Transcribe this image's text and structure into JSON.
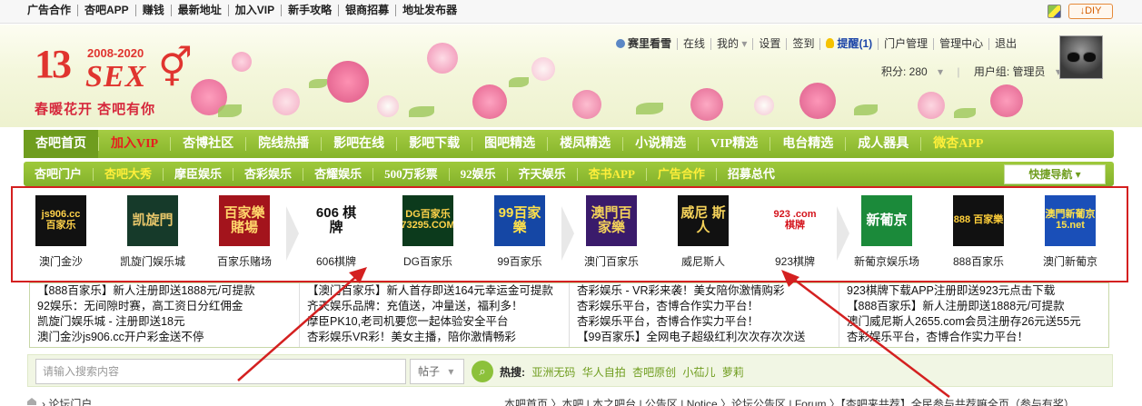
{
  "topbar": {
    "links": [
      {
        "label": "广告合作",
        "red": true
      },
      {
        "label": "杏吧APP",
        "red": false
      },
      {
        "label": "赚钱",
        "red": false
      },
      {
        "label": "最新地址",
        "red": false
      },
      {
        "label": "加入VIP",
        "red": true
      },
      {
        "label": "新手攻略",
        "red": true
      },
      {
        "label": "银商招募",
        "red": false
      },
      {
        "label": "地址发布器",
        "red": false
      }
    ],
    "diy_label": "↓DIY"
  },
  "logo": {
    "number": "13",
    "years": "2008-2020",
    "text": "SEX",
    "slogan": "春暖花开 杏吧有你"
  },
  "user": {
    "name": "赛里看雪",
    "status": "在线",
    "my": "我的",
    "settings": "设置",
    "checkin": "签到",
    "remind": "提醒(1)",
    "portal_admin": "门户管理",
    "admin_center": "管理中心",
    "logout": "退出",
    "points": "积分: 280",
    "group": "用户组: 管理员"
  },
  "nav1": [
    {
      "label": "杏吧首页",
      "style": "active"
    },
    {
      "label": "加入VIP",
      "style": "red"
    },
    {
      "label": "杏博社区",
      "style": ""
    },
    {
      "label": "院线热播",
      "style": ""
    },
    {
      "label": "影吧在线",
      "style": ""
    },
    {
      "label": "影吧下载",
      "style": ""
    },
    {
      "label": "图吧精选",
      "style": ""
    },
    {
      "label": "楼凤精选",
      "style": ""
    },
    {
      "label": "小说精选",
      "style": ""
    },
    {
      "label": "VIP精选",
      "style": ""
    },
    {
      "label": "电台精选",
      "style": ""
    },
    {
      "label": "成人器具",
      "style": ""
    },
    {
      "label": "微杏APP",
      "style": "yellow"
    }
  ],
  "nav2": [
    {
      "label": "杏吧门户",
      "style": ""
    },
    {
      "label": "杏吧大秀",
      "style": "yellow"
    },
    {
      "label": "摩臣娱乐",
      "style": ""
    },
    {
      "label": "杏彩娱乐",
      "style": ""
    },
    {
      "label": "杏耀娱乐",
      "style": ""
    },
    {
      "label": "500万彩票",
      "style": ""
    },
    {
      "label": "92娱乐",
      "style": ""
    },
    {
      "label": "齐天娱乐",
      "style": ""
    },
    {
      "label": "杏书APP",
      "style": "yellow"
    },
    {
      "label": "广告合作",
      "style": "yellow"
    },
    {
      "label": "招募总代",
      "style": ""
    }
  ],
  "quicknav_label": "快捷导航 ▾",
  "ad_tiles": [
    {
      "label": "澳门金沙",
      "img": "js906.cc 百家乐",
      "bg": "#111111",
      "fg": "#ffd24a"
    },
    {
      "label": "凯旋门娱乐城",
      "img": "凯旋門",
      "bg": "#163a2a",
      "fg": "#e7c66a"
    },
    {
      "label": "百家乐赌场",
      "img": "百家樂 賭場",
      "bg": "#a3141c",
      "fg": "#ffd66b"
    },
    {
      "label": "606棋牌",
      "img": "606 棋牌",
      "bg": "#ffffff",
      "fg": "#111111"
    },
    {
      "label": "DG百家乐",
      "img": "DG百家乐 73295.COM",
      "bg": "#0c3a1c",
      "fg": "#ffd34a"
    },
    {
      "label": "99百家乐",
      "img": "99百家樂",
      "bg": "#1547a5",
      "fg": "#ffe14a"
    },
    {
      "label": "澳门百家乐",
      "img": "澳門百家樂",
      "bg": "#3a1b6b",
      "fg": "#f2d15a"
    },
    {
      "label": "威尼斯人",
      "img": "威尼 斯人",
      "bg": "#111111",
      "fg": "#f5d25a"
    },
    {
      "label": "923棋牌",
      "img": "923 .com 棋牌",
      "bg": "#ffffff",
      "fg": "#d4141c"
    },
    {
      "label": "新葡京娱乐场",
      "img": "新葡京",
      "bg": "#1b8a3a",
      "fg": "#ffffff"
    },
    {
      "label": "888百家乐",
      "img": "888 百家樂",
      "bg": "#111111",
      "fg": "#ffcf3a"
    },
    {
      "label": "澳门新葡京",
      "img": "澳門新葡京 15.net",
      "bg": "#1a4fb8",
      "fg": "#ffe24a"
    }
  ],
  "text_ads": [
    [
      "【888百家乐】新人注册即送1888元/可提款",
      "92娱乐：无间隙时赛，高工资日分红佣金",
      "凯旋门娱乐城 - 注册即送18元",
      "澳门金沙js906.cc开户彩金送不停"
    ],
    [
      "【澳门百家乐】新人首存即送164元幸运金可提款",
      "齐天娱乐品牌：充值送，冲量送，福利多！",
      "摩臣PK10,老司机要您一起体验安全平台",
      "杏彩娱乐VR彩！美女主播，陪你激情畅彩"
    ],
    [
      "杏彩娱乐 - VR彩来袭！美女陪你激情购彩",
      "杏彩娱乐平台，杏博合作实力平台！",
      "杏彩娱乐平台，杏博合作实力平台！",
      "【99百家乐】全网电子超级红利次次存次次送"
    ],
    [
      "923棋牌下载APP注册即送923元点击下载",
      "【888百家乐】新人注册即送1888元/可提款",
      "澳门威尼斯人2655.com会员注册存26元送55元",
      "杏彩娱乐平台，杏博合作实力平台！"
    ]
  ],
  "search": {
    "placeholder": "请输入搜索内容",
    "select": "帖子",
    "hot_label": "热搜:",
    "hot_keywords": [
      "亚洲无码",
      "华人自拍",
      "杏吧原创",
      "小苮儿",
      "萝莉"
    ]
  },
  "breadcrumb": "论坛门户",
  "bottom_right": "本吧首页 〉本吧 | 本之吧台 | 公告区 | Notice 〉论坛公告区 | Forum 〉【杏吧来共荐】全民参与共荐嘛全页（参与有奖）",
  "colors": {
    "nav_green": "#8dbb2f",
    "accent_red": "#d40000",
    "highlight_yellow": "#ffef3a",
    "annotation_red": "#d42020"
  }
}
